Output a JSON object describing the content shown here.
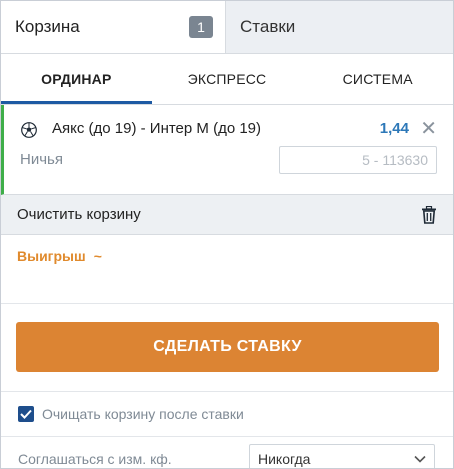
{
  "top_tabs": {
    "cart_label": "Корзина",
    "cart_count": "1",
    "bets_label": "Ставки"
  },
  "sub_tabs": [
    {
      "label": "ОРДИНАР",
      "active": true
    },
    {
      "label": "ЭКСПРЕСС",
      "active": false
    },
    {
      "label": "СИСТЕМА",
      "active": false
    }
  ],
  "bet": {
    "icon": "soccer-ball-icon",
    "match": "Аякс (до 19) - Интер М (до 19)",
    "odds": "1,44",
    "outcome": "Ничья",
    "stake_placeholder": "5 - 113630",
    "stake_value": ""
  },
  "clear": {
    "label": "Очистить корзину",
    "icon": "trash-icon"
  },
  "win": {
    "label": "Выигрыш",
    "value": "~"
  },
  "make_bet_label": "СДЕЛАТЬ СТАВКУ",
  "clear_after_bet": {
    "label": "Очищать корзину после ставки",
    "checked": true
  },
  "accept_odds": {
    "label": "Соглашаться с изм. кф.",
    "selected": "Никогда"
  },
  "colors": {
    "accent_blue": "#1d5aa3",
    "odds_blue": "#2d78b8",
    "button_orange": "#dc8433",
    "win_orange": "#e08a2d",
    "bet_green": "#3fae49"
  }
}
